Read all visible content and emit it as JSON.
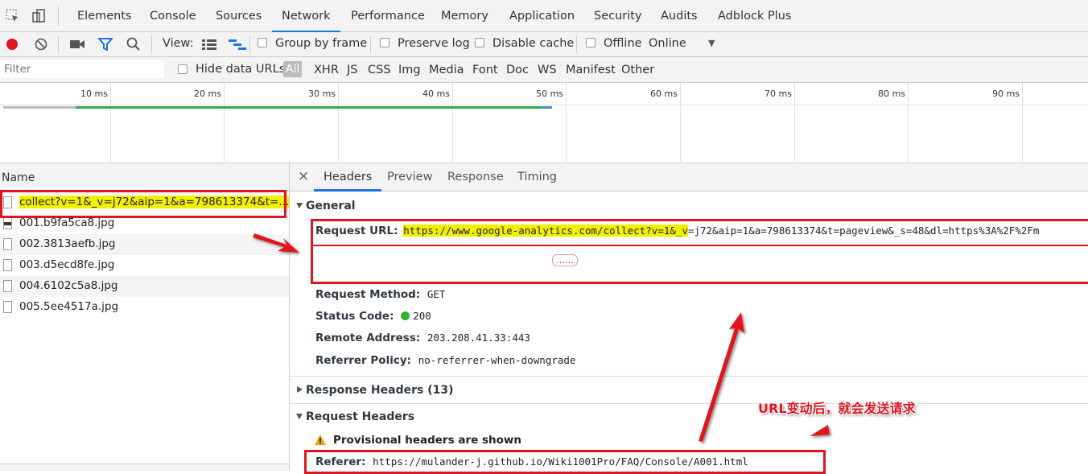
{
  "top_tabs": [
    "Elements",
    "Console",
    "Sources",
    "Network",
    "Performance",
    "Memory",
    "Application",
    "Security",
    "Audits",
    "Adblock Plus"
  ],
  "toolbar": {
    "view_label": "View:",
    "group_by_frame": "Group by frame",
    "preserve_log": "Preserve log",
    "disable_cache": "Disable cache",
    "offline": "Offline",
    "throttle": "Online",
    "throttle_caret": "▼"
  },
  "filter_bar": {
    "placeholder": "Filter",
    "hide_data_urls": "Hide data URLs",
    "types": [
      "All",
      "XHR",
      "JS",
      "CSS",
      "Img",
      "Media",
      "Font",
      "Doc",
      "WS",
      "Manifest",
      "Other"
    ]
  },
  "timeline": {
    "ticks": [
      "10 ms",
      "20 ms",
      "30 ms",
      "40 ms",
      "50 ms",
      "60 ms",
      "70 ms",
      "80 ms",
      "90 ms"
    ]
  },
  "request_list": {
    "header": "Name",
    "items": [
      "collect?v=1&_v=j72&aip=1&a=798613374&t=...",
      "001.b9fa5ca8.jpg",
      "002.3813aefb.jpg",
      "003.d5ecd8fe.jpg",
      "004.6102c5a8.jpg",
      "005.5ee4517a.jpg"
    ]
  },
  "detail_tabs": [
    "Headers",
    "Preview",
    "Response",
    "Timing"
  ],
  "close_glyph": "×",
  "general": {
    "title": "General",
    "request_url_label": "Request URL:",
    "request_url_highlight": "https://www.google-analytics.com/collect?v=1&_v",
    "request_url_rest": "=j72&aip=1&a=798613374&t=pageview&_s=48&dl=https%3A%2F%2Fm",
    "ellipsis": "……",
    "request_method_label": "Request Method:",
    "request_method": "GET",
    "status_code_label": "Status Code:",
    "status_code": "200",
    "remote_address_label": "Remote Address:",
    "remote_address": "203.208.41.33:443",
    "referrer_policy_label": "Referrer Policy:",
    "referrer_policy": "no-referrer-when-downgrade"
  },
  "response_headers": {
    "title": "Response Headers (13)"
  },
  "request_headers": {
    "title": "Request Headers",
    "warning": "Provisional headers are shown",
    "referer_label": "Referer:",
    "referer": "https://mulander-j.github.io/Wiki1001Pro/FAQ/Console/A001.html"
  },
  "annotation": {
    "text": "URL变动后，就会发送请求"
  },
  "colors": {
    "accent": "#1a73e8",
    "highlight": "#f0f000",
    "annotation_red": "#e0141e",
    "status_green": "#2eb82e"
  }
}
